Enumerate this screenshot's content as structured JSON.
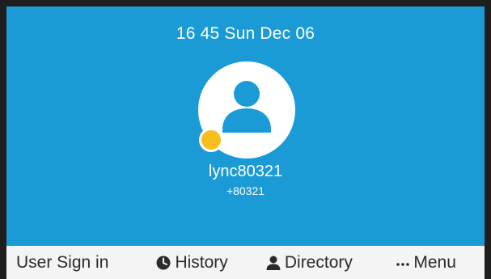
{
  "status_bar": {
    "clock": "16 45 Sun Dec 06"
  },
  "account": {
    "name": "lync80321",
    "number": "+80321",
    "presence_color": "#f7bf1e"
  },
  "softkeys": [
    {
      "label": "User Sign in",
      "icon": ""
    },
    {
      "label": "History",
      "icon": "clock-icon"
    },
    {
      "label": "Directory",
      "icon": "person-icon"
    },
    {
      "label": "Menu",
      "icon": "more-dots-icon"
    }
  ],
  "colors": {
    "screen_background": "#1a9bd6",
    "softkey_bar": "#f4f4f4",
    "text_dark": "#2b2b2b",
    "text_light": "#ffffff"
  }
}
